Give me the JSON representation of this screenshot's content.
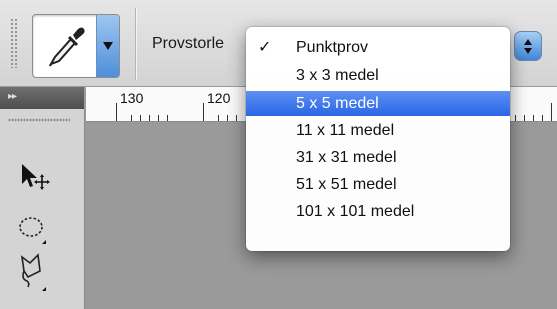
{
  "options_bar": {
    "tool_preset_icon": "eyedropper-icon",
    "sample_size_label": "Provstorle"
  },
  "ruler": {
    "marks": [
      "130",
      "120"
    ]
  },
  "tools": [
    {
      "name": "move-tool-icon"
    },
    {
      "name": "ellipse-marquee-tool-icon"
    },
    {
      "name": "polygonal-lasso-tool-icon"
    }
  ],
  "sample_size_menu": {
    "items": [
      {
        "label": "Punktprov",
        "checked": true,
        "highlighted": false
      },
      {
        "label": "3 x 3 medel",
        "checked": false,
        "highlighted": false
      },
      {
        "label": "5 x 5 medel",
        "checked": false,
        "highlighted": true
      },
      {
        "label": "11 x 11 medel",
        "checked": false,
        "highlighted": false
      },
      {
        "label": "31 x 31 medel",
        "checked": false,
        "highlighted": false
      },
      {
        "label": "51 x 51 medel",
        "checked": false,
        "highlighted": false
      },
      {
        "label": "101 x 101 medel",
        "checked": false,
        "highlighted": false
      }
    ],
    "check_mark": "✓"
  },
  "panel_collapse_glyph": "▸▸",
  "colors": {
    "highlight": "#3a73ea",
    "stepper_blue": "#4d8fdb"
  }
}
